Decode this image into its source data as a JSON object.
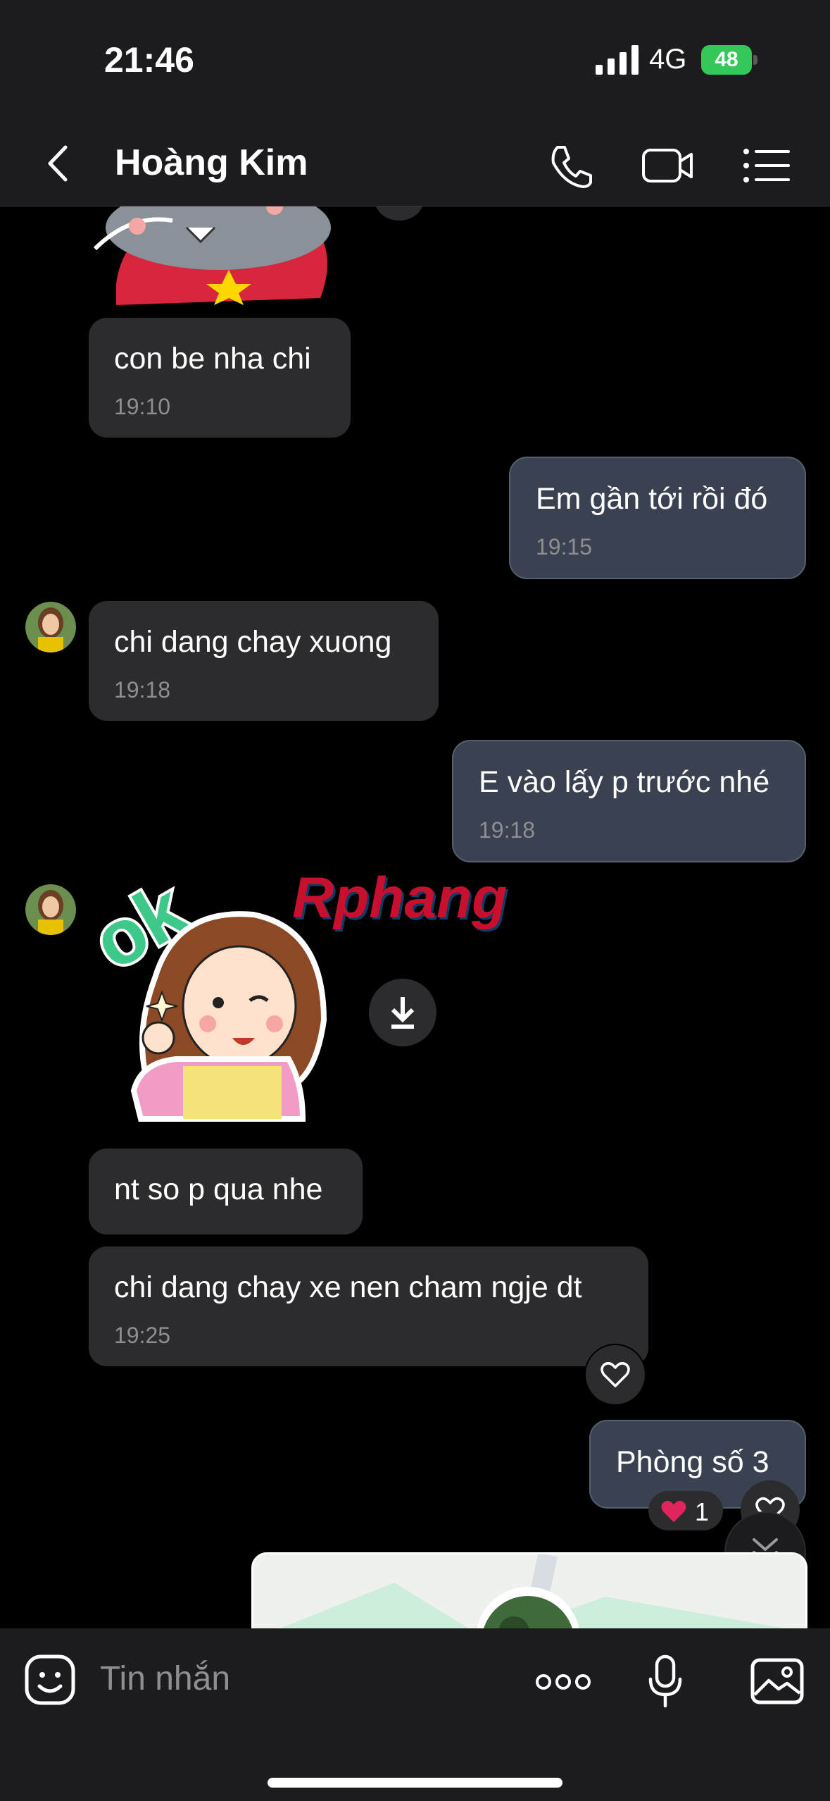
{
  "status_bar": {
    "time": "21:46",
    "network": "4G",
    "battery": "48"
  },
  "header": {
    "title": "Hoàng Kim"
  },
  "messages": [
    {
      "text": "con be nha chi",
      "time": "19:10"
    },
    {
      "text": "Em gần tới rồi đó",
      "time": "19:15"
    },
    {
      "text": "chi dang chay xuong",
      "time": "19:18"
    },
    {
      "text": "E vào lấy p trước nhé",
      "time": "19:18"
    },
    {
      "text": "nt so p qua nhe"
    },
    {
      "text": "chi dang chay xe  nen cham ngje dt",
      "time": "19:25"
    },
    {
      "text": "Phòng số 3",
      "reaction_count": "1"
    }
  ],
  "sticker_text": "ok",
  "watermark": "Rphang",
  "input": {
    "placeholder": "Tin nhắn"
  },
  "colors": {
    "incoming_bubble": "#2c2c2e",
    "outgoing_bubble": "#3a4150",
    "battery": "#34c759",
    "heart": "#e0245e"
  }
}
